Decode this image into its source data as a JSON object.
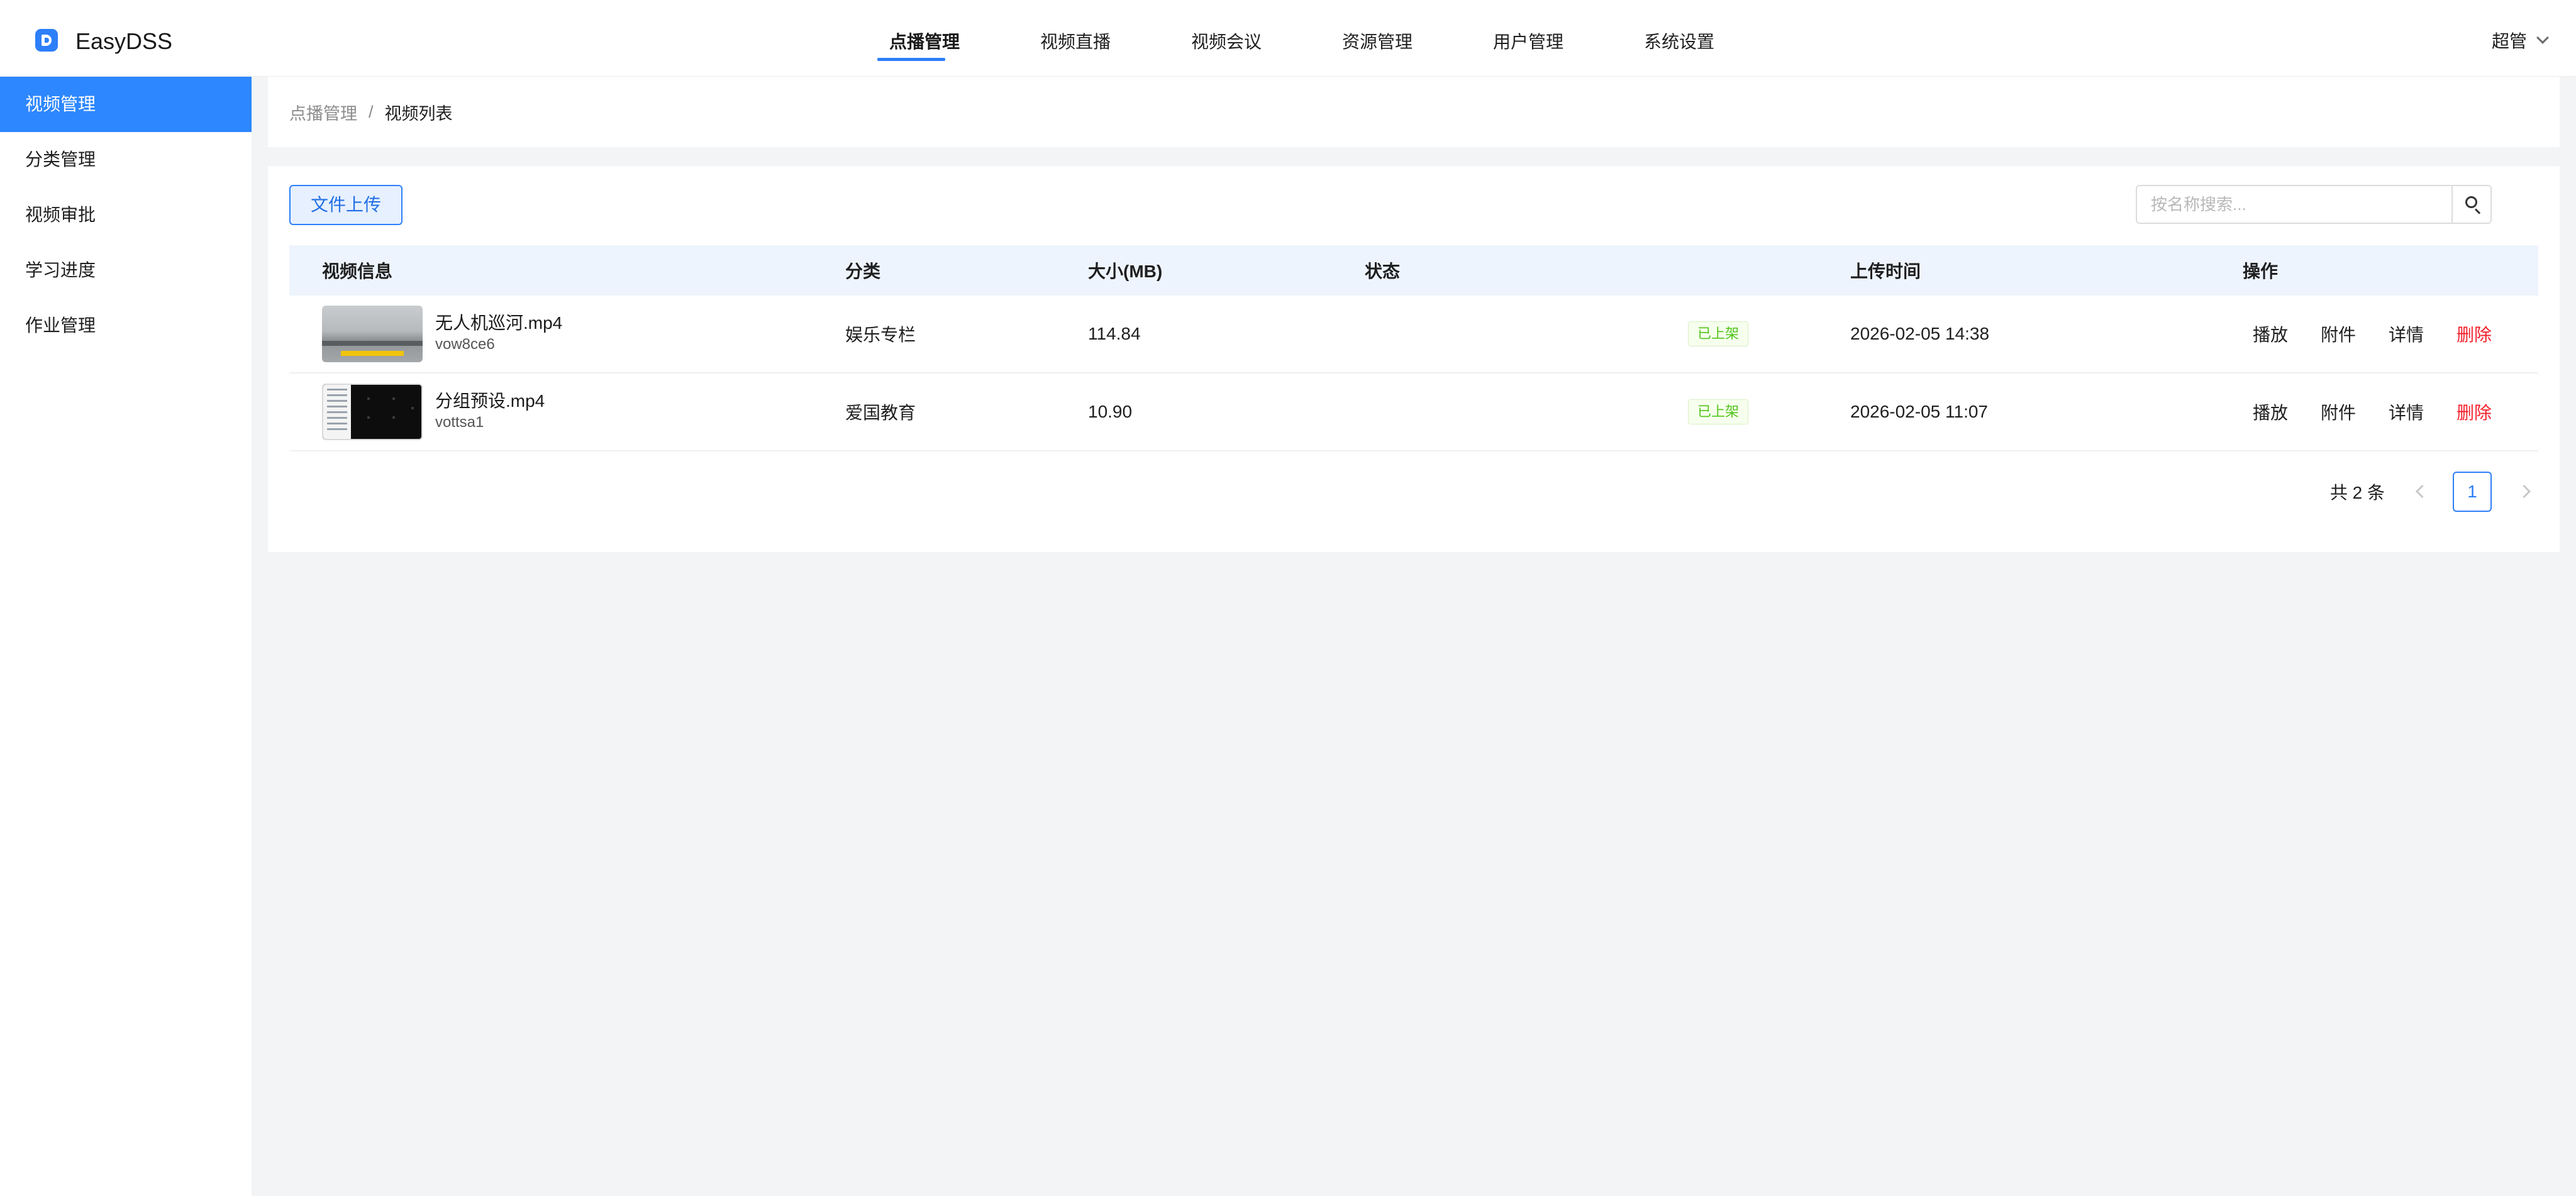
{
  "app": {
    "title": "EasyDSS"
  },
  "top_nav": [
    {
      "label": "点播管理",
      "active": true
    },
    {
      "label": "视频直播",
      "active": false
    },
    {
      "label": "视频会议",
      "active": false
    },
    {
      "label": "资源管理",
      "active": false
    },
    {
      "label": "用户管理",
      "active": false
    },
    {
      "label": "系统设置",
      "active": false
    }
  ],
  "user": {
    "name": "超管",
    "icon": "chevron-down-icon"
  },
  "sidebar": {
    "items": [
      {
        "label": "视频管理",
        "active": true
      },
      {
        "label": "分类管理",
        "active": false
      },
      {
        "label": "视频审批",
        "active": false
      },
      {
        "label": "学习进度",
        "active": false
      },
      {
        "label": "作业管理",
        "active": false
      }
    ]
  },
  "breadcrumb": {
    "parent": "点播管理",
    "separator": "/",
    "current": "视频列表"
  },
  "toolbar": {
    "upload_label": "文件上传",
    "search_placeholder": "按名称搜索...",
    "search_icon": "search-icon"
  },
  "table": {
    "headers": [
      "视频信息",
      "分类",
      "大小(MB)",
      "状态",
      "上传时间",
      "操作"
    ],
    "rows": [
      {
        "name": "无人机巡河.mp4",
        "id": "vow8ce6",
        "category": "娱乐专栏",
        "size": "114.84",
        "status": "已上架",
        "uploaded": "2026-02-05 14:38"
      },
      {
        "name": "分组预设.mp4",
        "id": "vottsa1",
        "category": "爱国教育",
        "size": "10.90",
        "status": "已上架",
        "uploaded": "2026-02-05 11:07"
      }
    ],
    "actions": [
      "播放",
      "附件",
      "详情",
      "删除"
    ]
  },
  "pagination": {
    "total_text": "共 2 条",
    "current_page": "1"
  },
  "colors": {
    "accent": "#2d7ff9",
    "sidebar_active": "#2d87ff",
    "danger": "#f5222d",
    "status_green": "#52c41a"
  }
}
